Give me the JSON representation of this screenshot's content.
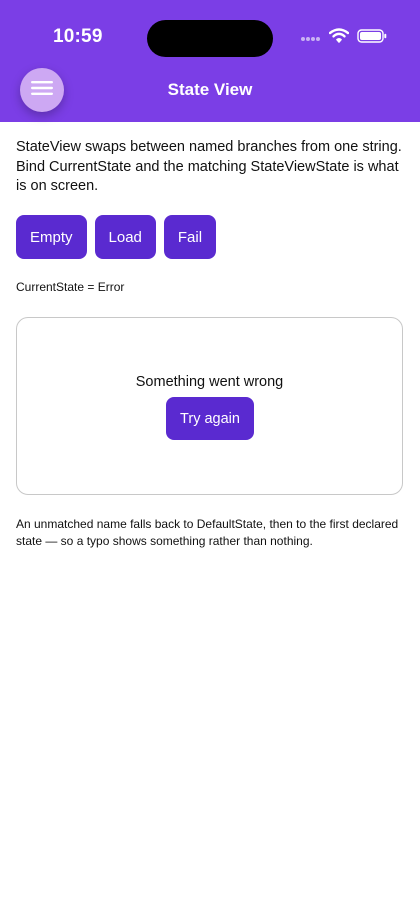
{
  "status_bar": {
    "time": "10:59"
  },
  "header": {
    "title": "State View",
    "menu_icon": "hamburger-icon",
    "background": "#7b3ee6"
  },
  "content": {
    "intro": "StateView swaps between named branches from one string. Bind CurrentState and the matching StateViewState is what is on screen.",
    "buttons": [
      {
        "label": "Empty"
      },
      {
        "label": "Load"
      },
      {
        "label": "Fail"
      }
    ],
    "current_state_text": "CurrentState = Error",
    "error_card": {
      "message": "Something went wrong",
      "retry_label": "Try again"
    },
    "footer_note": "An unmatched name falls back to DefaultState, then to the first declared state — so a typo shows something rather than nothing."
  },
  "colors": {
    "accent": "#5a2ad0",
    "menu_button": "#cda8f3"
  }
}
